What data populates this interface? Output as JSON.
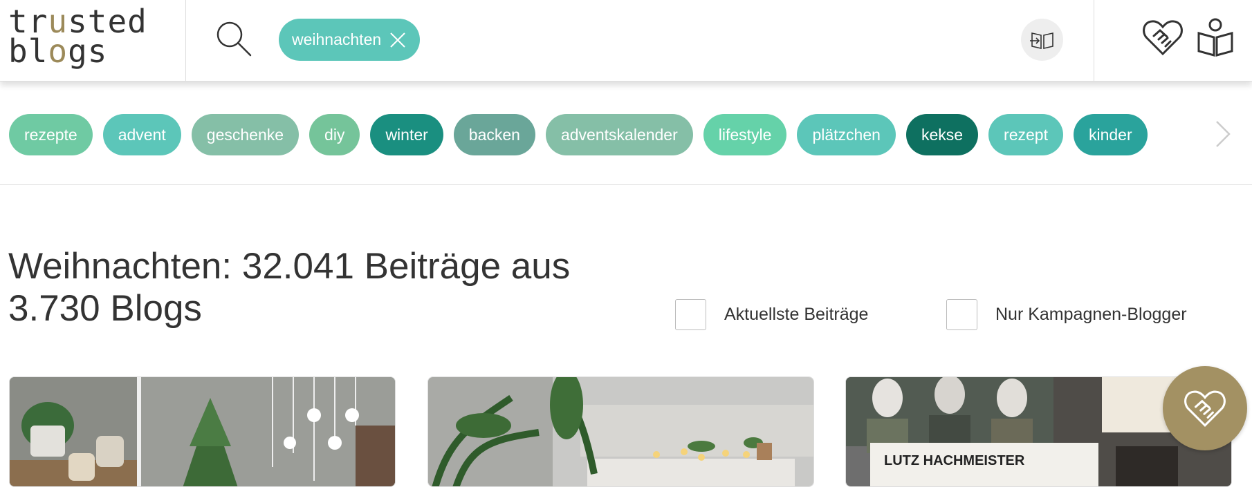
{
  "header": {
    "logo_line1": "tr",
    "logo_accent1": "u",
    "logo_line1_end": "sted",
    "logo_line2": "bl",
    "logo_accent2": "o",
    "logo_line2_end": "gs",
    "active_tag": "weihnachten"
  },
  "tags": [
    {
      "label": "rezepte",
      "color": "#6fcaa3"
    },
    {
      "label": "advent",
      "color": "#5cc6b9"
    },
    {
      "label": "geschenke",
      "color": "#85bfa7"
    },
    {
      "label": "diy",
      "color": "#75c49a"
    },
    {
      "label": "winter",
      "color": "#1a8f80"
    },
    {
      "label": "backen",
      "color": "#6aa699"
    },
    {
      "label": "adventskalender",
      "color": "#85bfa7"
    },
    {
      "label": "lifestyle",
      "color": "#65d2a9"
    },
    {
      "label": "plätzchen",
      "color": "#5cc6b9"
    },
    {
      "label": "kekse",
      "color": "#0e7060"
    },
    {
      "label": "rezept",
      "color": "#5cc6b9"
    },
    {
      "label": "kinder",
      "color": "#2aa39c"
    }
  ],
  "title": {
    "line1": "Weihnachten: 32.041 Beiträge aus",
    "line2": "3.730 Blogs"
  },
  "filters": {
    "latest_label": "Aktuellste Beiträge",
    "campaign_label": "Nur Kampagnen-Blogger"
  },
  "cards": [
    {
      "image": "christmas-plants-and-candles"
    },
    {
      "image": "living-room-sideboard-with-candles"
    },
    {
      "image": "book-cover-lutz-hachmeister",
      "cover_text": "LUTZ HACHMEISTER"
    }
  ],
  "colors": {
    "brand_gold": "#a39163",
    "accent_teal": "#5cc6b9"
  }
}
